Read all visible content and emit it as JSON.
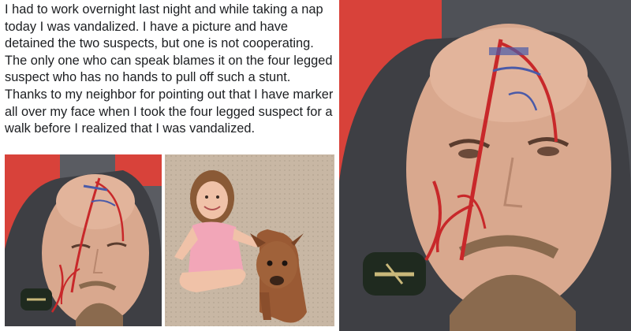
{
  "post": {
    "text": "I had to work overnight last night and while taking a nap today I was vandalized. I have a picture and have detained the two suspects, but one is not cooperating.  The only one who can speak blames it on the four legged suspect who has no hands to pull off such a stunt. Thanks to my neighbor for pointing out that I have marker all over my face when I took the four legged suspect for a walk before I realized that I was vandalized."
  },
  "colors": {
    "text": "#1c1e21",
    "pillow": "#d8423a",
    "hoodie": "#3e3f44",
    "skin": "#d9a88e",
    "marker_red": "#c8282a",
    "marker_blue": "#4a5aa8",
    "carpet": "#c8b7a4",
    "dog": "#9a5a34",
    "dress": "#f2a6b8"
  },
  "photos": [
    {
      "name": "photo-man-face-small",
      "subject": "man with marker drawn on face"
    },
    {
      "name": "photo-girl-and-dog",
      "subject": "girl and dog on carpet"
    },
    {
      "name": "photo-man-face-large",
      "subject": "man with marker drawn on face close-up"
    }
  ]
}
